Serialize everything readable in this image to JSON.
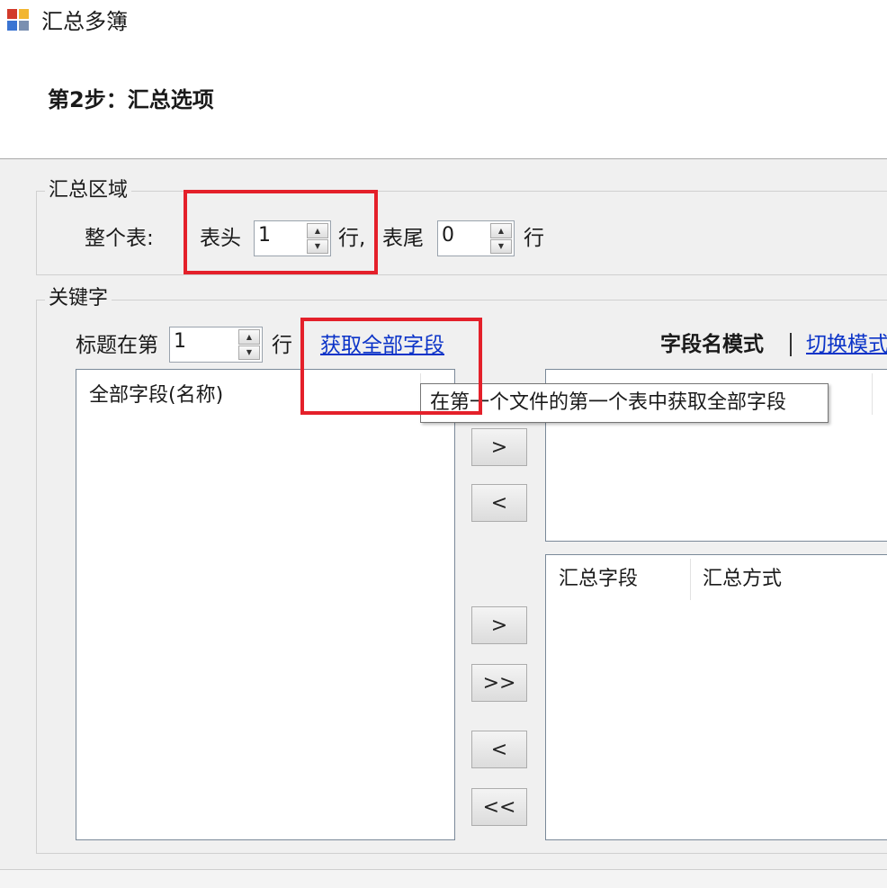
{
  "window": {
    "title": "汇总多簿"
  },
  "step": {
    "title": "第2步：汇总选项"
  },
  "summary_area": {
    "legend": "汇总区域",
    "whole_table_label": "整个表:",
    "header_label": "表头",
    "header_value": "1",
    "rows_label_1": "行,",
    "footer_label": "表尾",
    "footer_value": "0",
    "rows_label_2": "行"
  },
  "keyword": {
    "legend": "关键字",
    "title_row_prefix": "标题在第",
    "title_row_value": "1",
    "title_row_suffix": "行",
    "get_all_fields_link": "获取全部字段",
    "field_name_mode": "字段名模式",
    "switch_mode_link": "切换模式"
  },
  "all_fields_list": {
    "header": "全部字段(名称)"
  },
  "summary_fields_list": {
    "col1": "汇总字段",
    "col2": "汇总方式"
  },
  "transfer_buttons": {
    "add": ">",
    "remove": "<",
    "add_all": ">>",
    "remove_all": "<<"
  },
  "tooltip": {
    "text": "在第一个文件的第一个表中获取全部字段"
  },
  "colors": {
    "highlight": "#e4202a",
    "link": "#0b33c8"
  }
}
